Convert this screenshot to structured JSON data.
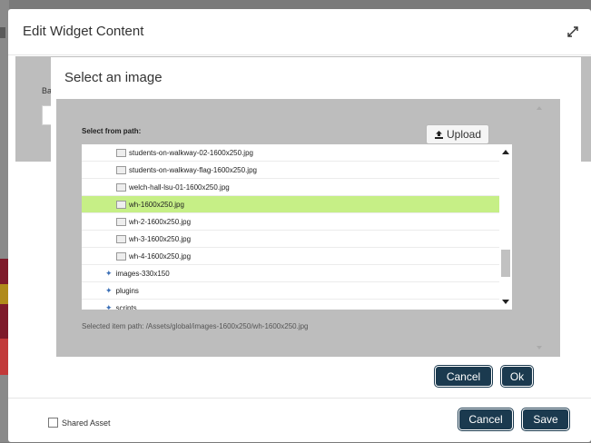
{
  "outer_dialog": {
    "title": "Edit Widget Content",
    "background_label": "Ba",
    "shared_asset_label": "Shared Asset",
    "cancel_label": "Cancel",
    "save_label": "Save"
  },
  "image_dialog": {
    "title": "Select an image",
    "select_from_path_label": "Select from path:",
    "upload_label": "Upload",
    "tree_items": [
      {
        "label": "students-on-walkway-02-1600x250.jpg",
        "type": "file",
        "selected": false
      },
      {
        "label": "students-on-walkway-flag-1600x250.jpg",
        "type": "file",
        "selected": false
      },
      {
        "label": "welch-hall-lsu-01-1600x250.jpg",
        "type": "file",
        "selected": false
      },
      {
        "label": "wh-1600x250.jpg",
        "type": "file",
        "selected": true
      },
      {
        "label": "wh-2-1600x250.jpg",
        "type": "file",
        "selected": false
      },
      {
        "label": "wh-3-1600x250.jpg",
        "type": "file",
        "selected": false
      },
      {
        "label": "wh-4-1600x250.jpg",
        "type": "file",
        "selected": false
      },
      {
        "label": "images-330x150",
        "type": "folder",
        "selected": false
      },
      {
        "label": "plugins",
        "type": "folder",
        "selected": false
      },
      {
        "label": "scripts",
        "type": "folder",
        "selected": false
      }
    ],
    "selected_item_path": "Selected item path: /Assets/global/images-1600x250/wh-1600x250.jpg",
    "cancel_label": "Cancel",
    "ok_label": "Ok"
  },
  "colors": {
    "primary_button": "#1b3a4f",
    "selected_row": "#c6ef86",
    "folder_icon": "#3b6fb6"
  }
}
